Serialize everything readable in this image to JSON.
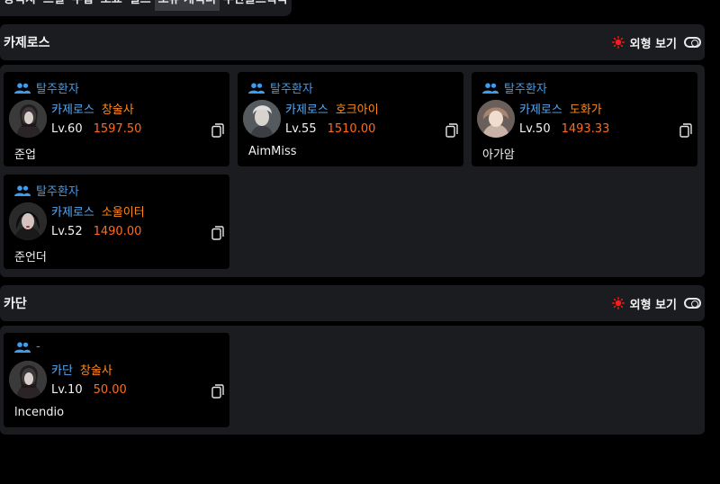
{
  "tabs": [
    "능력치",
    "스킬",
    "수집",
    "도표",
    "길드",
    "보유 캐릭터",
    "주간골드획득"
  ],
  "active_tab": 5,
  "appearance_label": "외형 보기",
  "colors": {
    "accent_blue": "#3b9df2",
    "class_orange": "#ff8a1c",
    "ilvl_orange": "#ff6a1c",
    "sun_red": "#ff1a1a"
  },
  "servers": [
    {
      "name": "카제로스",
      "characters": [
        {
          "guild": "탈주환자",
          "server": "카제로스",
          "class": "창술사",
          "level": "Lv.60",
          "item_level": "1597.50",
          "name": "준업"
        },
        {
          "guild": "탈주환자",
          "server": "카제로스",
          "class": "호크아이",
          "level": "Lv.55",
          "item_level": "1510.00",
          "name": "AimMiss"
        },
        {
          "guild": "탈주환자",
          "server": "카제로스",
          "class": "도화가",
          "level": "Lv.50",
          "item_level": "1493.33",
          "name": "아가암"
        },
        {
          "guild": "탈주환자",
          "server": "카제로스",
          "class": "소울이터",
          "level": "Lv.52",
          "item_level": "1490.00",
          "name": "준언더"
        }
      ]
    },
    {
      "name": "카단",
      "characters": [
        {
          "guild": "-",
          "server": "카단",
          "class": "창술사",
          "level": "Lv.10",
          "item_level": "50.00",
          "name": "lncendio"
        }
      ]
    }
  ]
}
